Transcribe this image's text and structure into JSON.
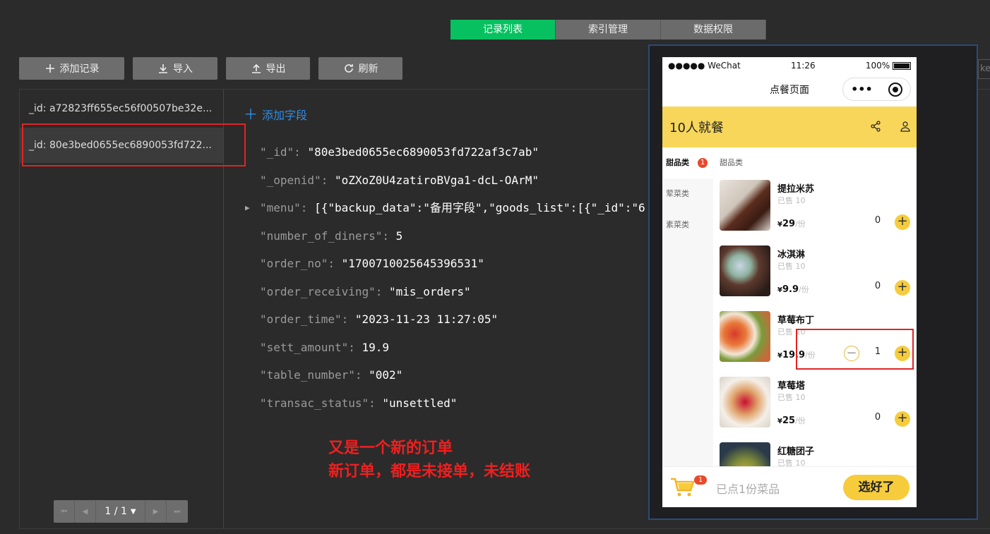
{
  "tabs": [
    "记录列表",
    "索引管理",
    "数据权限"
  ],
  "toolbar": {
    "add": "添加记录",
    "import": "导入",
    "export": "导出",
    "refresh": "刷新"
  },
  "search_fragment": "key",
  "records": [
    "_id: a72823ff655ec56f00507be32e...",
    "_id: 80e3bed0655ec6890053fd722..."
  ],
  "pager": {
    "value": "1 / 1"
  },
  "add_field": "添加字段",
  "fields": [
    {
      "key": "\"_id\"",
      "value": "\"80e3bed0655ec6890053fd722af3c7ab\""
    },
    {
      "key": "\"_openid\"",
      "value": "\"oZXoZ0U4zatiroBVga1-dcL-OArM\""
    },
    {
      "key": "\"menu\"",
      "value": "[{\"backup_data\":\"备用字段\",\"goods_list\":[{\"_id\":\"6"
    },
    {
      "key": "\"number_of_diners\"",
      "value": "5"
    },
    {
      "key": "\"order_no\"",
      "value": "\"1700710025645396531\""
    },
    {
      "key": "\"order_receiving\"",
      "value": "\"mis_orders\""
    },
    {
      "key": "\"order_time\"",
      "value": "\"2023-11-23 11:27:05\""
    },
    {
      "key": "\"sett_amount\"",
      "value": "19.9"
    },
    {
      "key": "\"table_number\"",
      "value": "\"002\""
    },
    {
      "key": "\"transac_status\"",
      "value": "\"unsettled\""
    }
  ],
  "annotation": {
    "line1": "又是一个新的订单",
    "line2": "新订单，都是未接单，未结账"
  },
  "phone": {
    "status": {
      "carrier": "●●●●● WeChat",
      "time": "11:26",
      "battery": "100%"
    },
    "nav_title": "点餐页面",
    "banner": "10人就餐",
    "categories": [
      {
        "name": "甜品类",
        "badge": "1"
      },
      {
        "name": "荤菜类"
      },
      {
        "name": "素菜类"
      }
    ],
    "goods_header": "甜品类",
    "goods": [
      {
        "name": "提拉米苏",
        "sold": "已售 10",
        "cur": "¥",
        "price": "29",
        "unit": "/份",
        "qty": "0"
      },
      {
        "name": "冰淇淋",
        "sold": "已售 10",
        "cur": "¥",
        "price": "9.9",
        "unit": "/份",
        "qty": "0"
      },
      {
        "name": "草莓布丁",
        "sold": "已售 10",
        "cur": "¥",
        "price": "19.9",
        "unit": "/份",
        "qty": "1"
      },
      {
        "name": "草莓塔",
        "sold": "已售 10",
        "cur": "¥",
        "price": "25",
        "unit": "/份",
        "qty": "0"
      },
      {
        "name": "红糖团子",
        "sold": "已售 10"
      }
    ],
    "cart_badge": "1",
    "cart_text": "已点1份菜品",
    "checkout": "选好了"
  },
  "colors": {
    "accent": "#07c160",
    "link": "#2e8ee8",
    "highlight": "#e02424",
    "brand_yellow": "#f7d65a"
  }
}
